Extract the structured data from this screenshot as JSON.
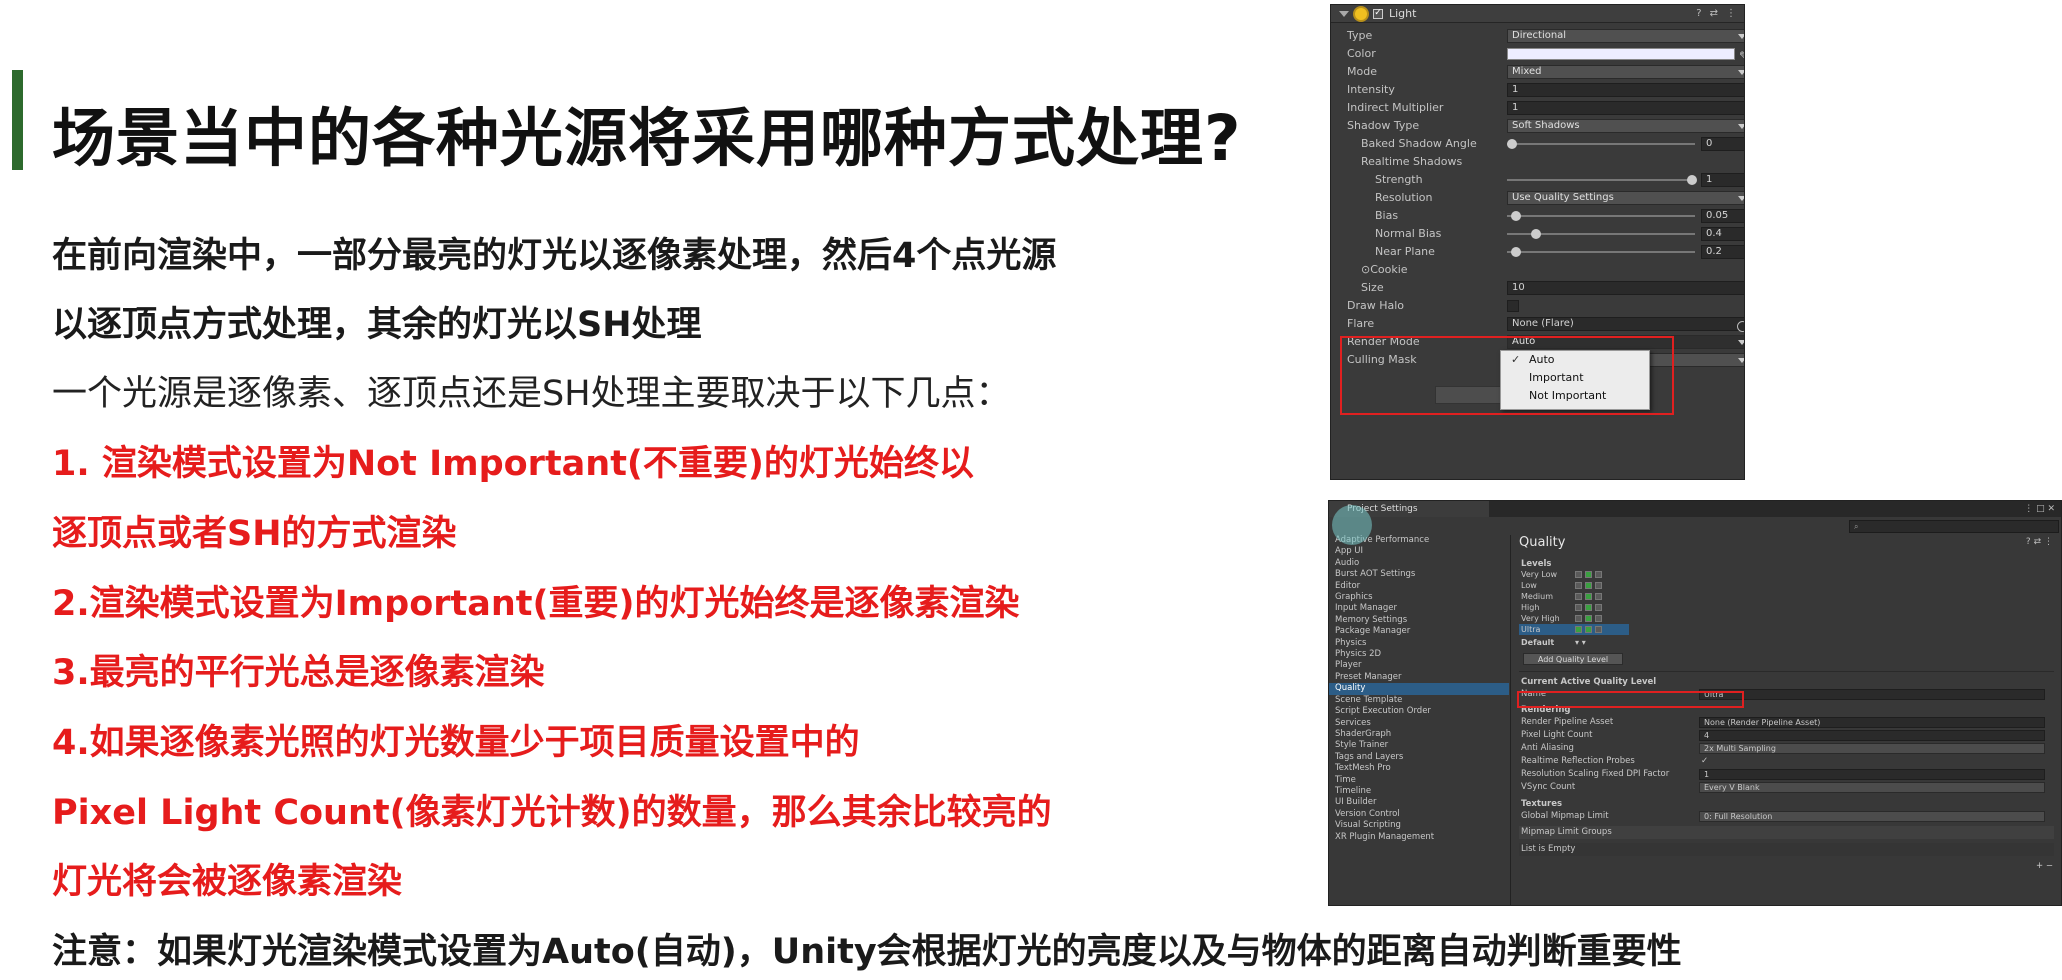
{
  "slide": {
    "title": "场景当中的各种光源将采用哪种方式处理?",
    "line1": "在前向渲染中，一部分最亮的灯光以逐像素处理，然后4个点光源",
    "line2": "以逐顶点方式处理，其余的灯光以SH处理",
    "line3": "一个光源是逐像素、逐顶点还是SH处理主要取决于以下几点：",
    "line4": "1. 渲染模式设置为Not Important(不重要)的灯光始终以",
    "line5": "逐顶点或者SH的方式渲染",
    "line6": "2.渲染模式设置为Important(重要)的灯光始终是逐像素渲染",
    "line7": "3.最亮的平行光总是逐像素渲染",
    "line8": "4.如果逐像素光照的灯光数量少于项目质量设置中的",
    "line9": "Pixel Light Count(像素灯光计数)的数量，那么其余比较亮的",
    "line10": "灯光将会被逐像素渲染",
    "note": "注意：如果灯光渲染模式设置为Auto(自动)，Unity会根据灯光的亮度以及与物体的距离自动判断重要性",
    "accent_color": "#2d6a2d",
    "red_color": "#e61c1c"
  },
  "inspector": {
    "component": "Light",
    "icons": [
      "help-icon",
      "preset-icon",
      "more-icon"
    ],
    "type_label": "Type",
    "type_value": "Directional",
    "color_label": "Color",
    "color_value": "#eeeeff",
    "mode_label": "Mode",
    "mode_value": "Mixed",
    "intensity_label": "Intensity",
    "intensity_value": "1",
    "indirect_label": "Indirect Multiplier",
    "indirect_value": "1",
    "shadow_type_label": "Shadow Type",
    "shadow_type_value": "Soft Shadows",
    "baked_angle_label": "Baked Shadow Angle",
    "baked_angle_value": "0",
    "realtime_label": "Realtime Shadows",
    "strength_label": "Strength",
    "strength_value": "1",
    "resolution_label": "Resolution",
    "resolution_value": "Use Quality Settings",
    "bias_label": "Bias",
    "bias_value": "0.05",
    "normal_bias_label": "Normal Bias",
    "normal_bias_value": "0.4",
    "near_plane_label": "Near Plane",
    "near_plane_value": "0.2",
    "cookie_label": "Cookie",
    "size_label": "Size",
    "size_value": "10",
    "draw_halo_label": "Draw Halo",
    "flare_label": "Flare",
    "flare_value": "None (Flare)",
    "render_mode_label": "Render Mode",
    "render_mode_value": "Auto",
    "culling_label": "Culling Mask",
    "render_mode_options": [
      "Auto",
      "Important",
      "Not Important"
    ]
  },
  "project_settings": {
    "tab_title": "Project Settings",
    "search_placeholder": "",
    "sidebar": [
      "Adaptive Performance",
      "App UI",
      "Audio",
      "Burst AOT Settings",
      "Editor",
      "Graphics",
      "Input Manager",
      "Memory Settings",
      "Package Manager",
      "Physics",
      "Physics 2D",
      "Player",
      "Preset Manager",
      "Quality",
      "Scene Template",
      "Script Execution Order",
      "Services",
      "ShaderGraph",
      "Style Trainer",
      "Tags and Layers",
      "TextMesh Pro",
      "Time",
      "Timeline",
      "UI Builder",
      "Version Control",
      "Visual Scripting",
      "XR Plugin Management"
    ],
    "selected": "Quality",
    "heading": "Quality",
    "levels_label": "Levels",
    "levels": [
      "Very Low",
      "Low",
      "Medium",
      "High",
      "Very High",
      "Ultra"
    ],
    "default_label": "Default",
    "add_level": "Add Quality Level",
    "current_label": "Current Active Quality Level",
    "name_label": "Name",
    "name_value": "Ultra",
    "rendering_label": "Rendering",
    "rp_label": "Render Pipeline Asset",
    "rp_value": "None (Render Pipeline Asset)",
    "plc_label": "Pixel Light Count",
    "plc_value": "4",
    "aa_label": "Anti Aliasing",
    "aa_value": "2x Multi Sampling",
    "rrp_label": "Realtime Reflection Probes",
    "rrp_value": "✓",
    "rs_label": "Resolution Scaling Fixed DPI Factor",
    "rs_value": "1",
    "vsync_label": "VSync Count",
    "vsync_value": "Every V Blank",
    "textures_label": "Textures",
    "gml_label": "Global Mipmap Limit",
    "gml_value": "0: Full Resolution",
    "mlg_label": "Mipmap Limit Groups",
    "empty_label": "List is Empty"
  }
}
